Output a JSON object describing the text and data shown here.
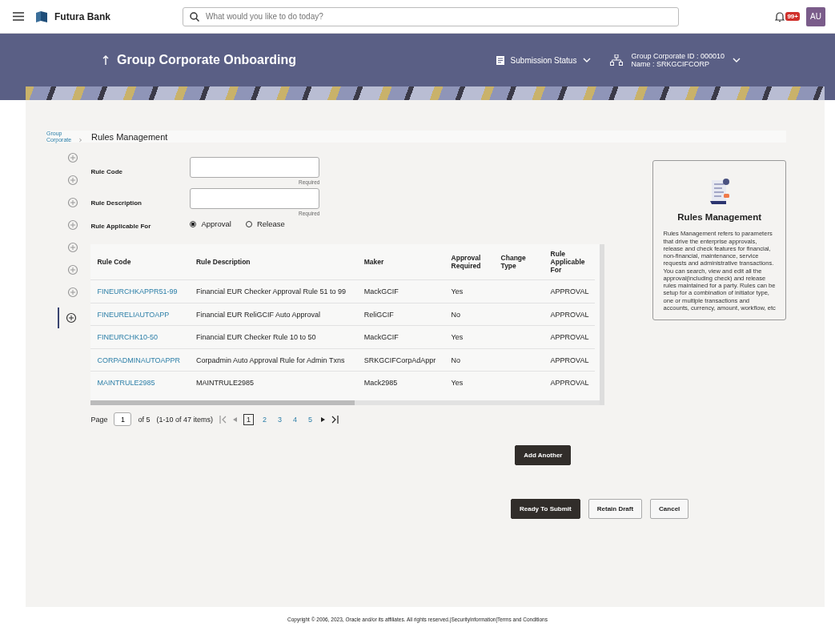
{
  "header": {
    "brand": "Futura Bank",
    "search": {
      "placeholder": "What would you like to do today?"
    },
    "notification_badge": "99+",
    "avatar": "AU"
  },
  "banner": {
    "title": "Group Corporate Onboarding",
    "submission_status": "Submission Status",
    "corporate_id": "Group Corporate ID : 000010",
    "corporate_name": "Name : SRKGCIFCORP"
  },
  "breadcrumb": {
    "parent": "Group Corporate",
    "current": "Rules Management"
  },
  "sidebar": {
    "items": [
      {
        "selected": false
      },
      {
        "selected": false
      },
      {
        "selected": false
      },
      {
        "selected": false
      },
      {
        "selected": false
      },
      {
        "selected": false
      },
      {
        "selected": false
      },
      {
        "selected": true
      }
    ]
  },
  "form": {
    "rule_code": {
      "label": "Rule Code",
      "hint": "Required"
    },
    "rule_description": {
      "label": "Rule Description",
      "hint": "Required"
    },
    "applicable_for": {
      "label": "Rule Applicable For",
      "options": [
        {
          "label": "Approval",
          "selected": true
        },
        {
          "label": "Release",
          "selected": false
        }
      ]
    }
  },
  "table": {
    "columns": [
      "Rule Code",
      "Rule Description",
      "Maker",
      "Approval Required",
      "Change Type",
      "Rule Applicable For"
    ],
    "rows": [
      [
        "FINEURCHKAPPR51-99",
        "Financial EUR Checker Approval Rule 51 to 99",
        "MackGCIF",
        "Yes",
        "",
        "APPROVAL"
      ],
      [
        "FINEURELIAUTOAPP",
        "Financial EUR ReliGCIF Auto Approval",
        "ReliGCIF",
        "No",
        "",
        "APPROVAL"
      ],
      [
        "FINEURCHK10-50",
        "Financial EUR Checker Rule 10 to 50",
        "MackGCIF",
        "Yes",
        "",
        "APPROVAL"
      ],
      [
        "CORPADMINAUTOAPPR",
        "Corpadmin Auto Approval Rule for Admin Txns",
        "SRKGCIFCorpAdAppr",
        "No",
        "",
        "APPROVAL"
      ],
      [
        "MAINTRULE2985",
        "MAINTRULE2985",
        "Mack2985",
        "Yes",
        "",
        "APPROVAL"
      ]
    ]
  },
  "pagination": {
    "label": "Page",
    "page": "1",
    "of": "of 5",
    "items": "(1-10 of 47 items)",
    "pages": [
      {
        "label": "1",
        "selected": true
      },
      {
        "label": "2",
        "selected": false
      },
      {
        "label": "3",
        "selected": false
      },
      {
        "label": "4",
        "selected": false
      },
      {
        "label": "5",
        "selected": false
      }
    ]
  },
  "add_button": "Add Another",
  "info_panel": {
    "title": "Rules Management",
    "text": "Rules Management refers to parameters that drive the enterprise approvals, release and check features for financial, non-financial, maintenance, service requests and administrative transactions. You can search, view and edit all the approval(including check) and release rules maintained for a party. Rules can be setup for a combination of initiator type, one or multiple transactions and accounts, currency, amount, workflow, etc"
  },
  "actions": [
    {
      "label": "Ready To Submit",
      "kind": "primary"
    },
    {
      "label": "Retain Draft",
      "kind": "secondary"
    },
    {
      "label": "Cancel",
      "kind": "secondary"
    }
  ],
  "footer": {
    "copyright": "Copyright © 2006, 2023, Oracle and/or its affiliates. All rights reserved.|SecurityInformation|Terms and Conditions"
  }
}
